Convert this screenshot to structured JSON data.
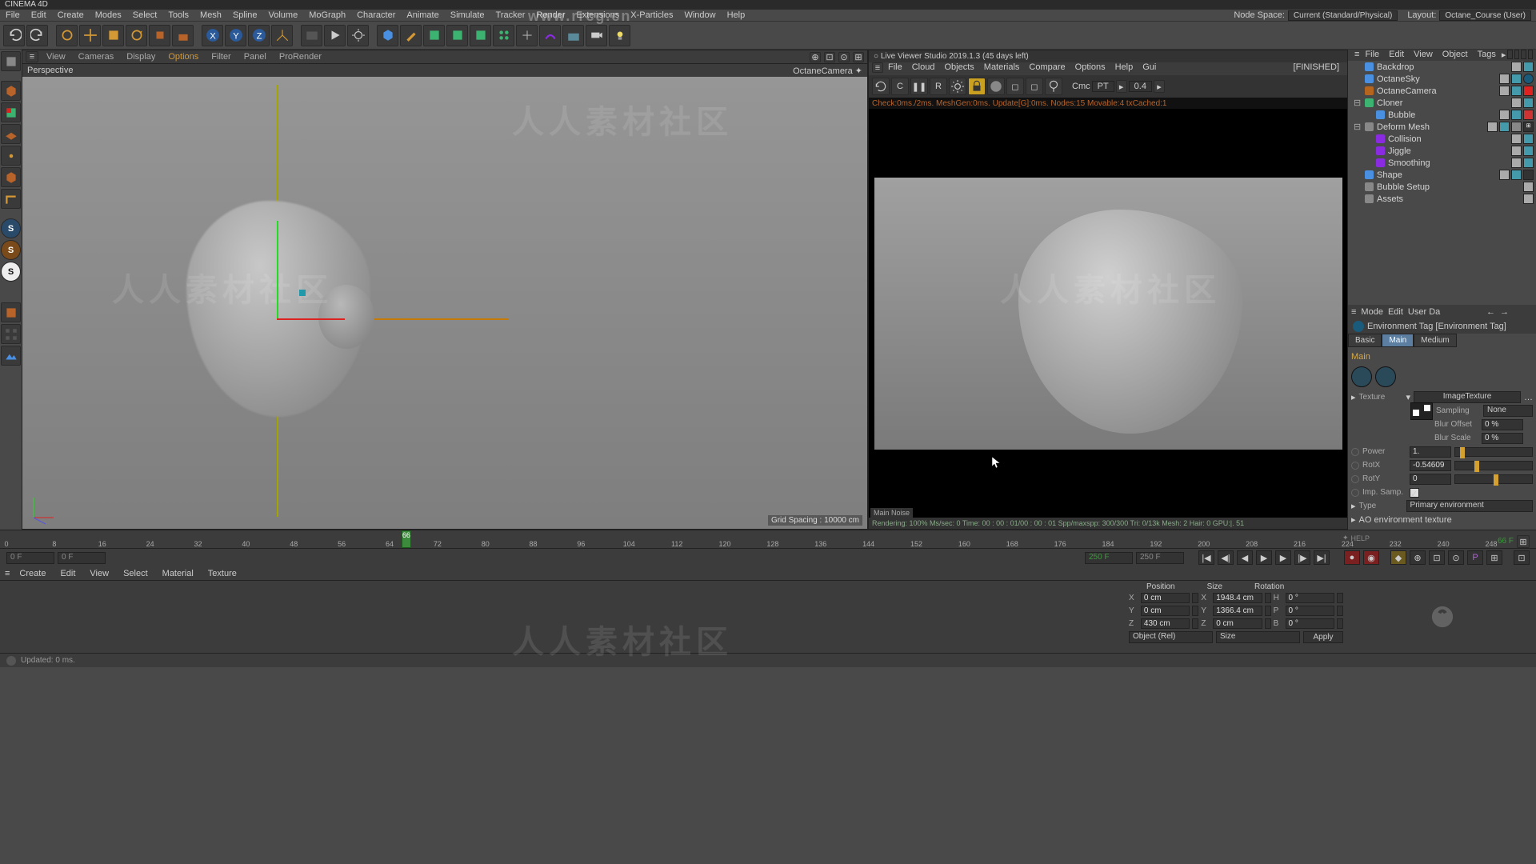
{
  "app_title": "CINEMA 4D",
  "top_watermark": "www.rrcg.cn",
  "menubar": {
    "items": [
      "File",
      "Edit",
      "Create",
      "Modes",
      "Select",
      "Tools",
      "Mesh",
      "Spline",
      "Volume",
      "MoGraph",
      "Character",
      "Animate",
      "Simulate",
      "Tracker",
      "Render",
      "Extensions",
      "X-Particles",
      "Window",
      "Help"
    ],
    "node_space_label": "Node Space:",
    "node_space_value": "Current (Standard/Physical)",
    "layout_label": "Layout:",
    "layout_value": "Octane_Course (User)"
  },
  "viewport": {
    "menu": [
      "View",
      "Cameras",
      "Display",
      "Options",
      "Filter",
      "Panel",
      "ProRender"
    ],
    "active_menu": "Options",
    "mode": "Perspective",
    "camera": "OctaneCamera",
    "grid_text": "Grid Spacing : 10000 cm"
  },
  "live_viewer": {
    "title": "Live Viewer Studio 2019.1.3 (45 days left)",
    "menu": [
      "File",
      "Cloud",
      "Objects",
      "Materials",
      "Compare",
      "Options",
      "Help",
      "Gui"
    ],
    "status_tag": "[FINISHED]",
    "toolbar": {
      "cmc_label": "Cmc",
      "cmc_value": "PT",
      "imap_value": "0.4"
    },
    "info_line": "Check:0ms./2ms. MeshGen:0ms. Update[G]:0ms. Nodes:15 Movable:4 txCached:1",
    "tabs": "Main  Noise",
    "status_bar": "Rendering: 100%   Ms/sec: 0   Time: 00 : 00 : 01/00 : 00 : 01   Spp/maxspp: 300/300   Tri: 0/13k   Mesh: 2  Hair: 0   GPU:|.   51"
  },
  "objects": [
    {
      "indent": 0,
      "name": "Backdrop",
      "icon": "#4a90e2",
      "tags": [
        "#aaa",
        "#49a"
      ],
      "mark": ""
    },
    {
      "indent": 0,
      "name": "OctaneSky",
      "icon": "#4a90e2",
      "tags": [
        "#aaa",
        "#49a"
      ],
      "mark": "env"
    },
    {
      "indent": 0,
      "name": "OctaneCamera",
      "icon": "#b5651d",
      "tags": [
        "#aaa",
        "#49a"
      ],
      "mark": "rec"
    },
    {
      "indent": 0,
      "name": "Cloner",
      "icon": "#3cb371",
      "tags": [
        "#aaa",
        "#49a"
      ],
      "mark": "",
      "expand": true
    },
    {
      "indent": 1,
      "name": "Bubble",
      "icon": "#4a90e2",
      "tags": [
        "#aaa",
        "#49a",
        "#c33"
      ],
      "mark": ""
    },
    {
      "indent": 0,
      "name": "Deform Mesh",
      "icon": "#888",
      "tags": [
        "#aaa",
        "#49a",
        "#888"
      ],
      "mark": "xp",
      "expand": true
    },
    {
      "indent": 1,
      "name": "Collision",
      "icon": "#8a2be2",
      "tags": [
        "#aaa",
        "#49a"
      ],
      "mark": ""
    },
    {
      "indent": 1,
      "name": "Jiggle",
      "icon": "#8a2be2",
      "tags": [
        "#aaa",
        "#49a"
      ],
      "mark": ""
    },
    {
      "indent": 1,
      "name": "Smoothing",
      "icon": "#8a2be2",
      "tags": [
        "#aaa",
        "#49a"
      ],
      "mark": ""
    },
    {
      "indent": 0,
      "name": "Shape",
      "icon": "#4a90e2",
      "tags": [
        "#aaa",
        "#49a",
        "#333"
      ],
      "mark": ""
    },
    {
      "indent": 0,
      "name": "Bubble Setup",
      "icon": "#888",
      "tags": [
        "#aaa"
      ],
      "mark": ""
    },
    {
      "indent": 0,
      "name": "Assets",
      "icon": "#888",
      "tags": [
        "#aaa"
      ],
      "mark": ""
    }
  ],
  "attr": {
    "menu": [
      "Mode",
      "Edit",
      "User Da"
    ],
    "title": "Environment Tag [Environment Tag]",
    "tabs": [
      "Basic",
      "Main",
      "Medium"
    ],
    "active_tab": "Main",
    "section": "Main",
    "texture_label": "Texture",
    "texture_value": "ImageTexture",
    "sampling_label": "Sampling",
    "sampling_value": "None",
    "blur_offset_label": "Blur Offset",
    "blur_offset_value": "0 %",
    "blur_scale_label": "Blur Scale",
    "blur_scale_value": "0 %",
    "power_label": "Power",
    "power_value": "1.",
    "rotx_label": "RotX",
    "rotx_value": "-0.54609",
    "roty_label": "RotY",
    "roty_value": "0",
    "imp_samp_label": "Imp. Samp.",
    "type_label": "Type",
    "type_value": "Primary environment",
    "ao_label": "AO environment texture"
  },
  "timeline": {
    "ticks": [
      "0",
      "8",
      "16",
      "24",
      "32",
      "40",
      "48",
      "56",
      "64",
      "72",
      "80",
      "88",
      "96",
      "104",
      "112",
      "120",
      "128",
      "136",
      "144",
      "152",
      "160",
      "168",
      "176",
      "184",
      "192",
      "200",
      "208",
      "216",
      "224",
      "232",
      "240",
      "248"
    ],
    "playhead": "66",
    "end_label": "66 F"
  },
  "playback": {
    "start": "0 F",
    "range_start": "0 F",
    "range_end": "250 F",
    "end": "250 F"
  },
  "mat_menu": [
    "Create",
    "Edit",
    "View",
    "Select",
    "Material",
    "Texture"
  ],
  "coords": {
    "headers": [
      "Position",
      "Size",
      "Rotation"
    ],
    "rows": [
      {
        "axis": "X",
        "pos": "0 cm",
        "size": "1948.4 cm",
        "rlabel": "H",
        "rot": "0 °"
      },
      {
        "axis": "Y",
        "pos": "0 cm",
        "size": "1366.4 cm",
        "rlabel": "P",
        "rot": "0 °"
      },
      {
        "axis": "Z",
        "pos": "430 cm",
        "size": "0 cm",
        "rlabel": "B",
        "rot": "0 °"
      }
    ],
    "mode1": "Object (Rel)",
    "mode2": "Size",
    "apply": "Apply"
  },
  "statusbar": "Updated: 0 ms.",
  "help_label": "HELP"
}
